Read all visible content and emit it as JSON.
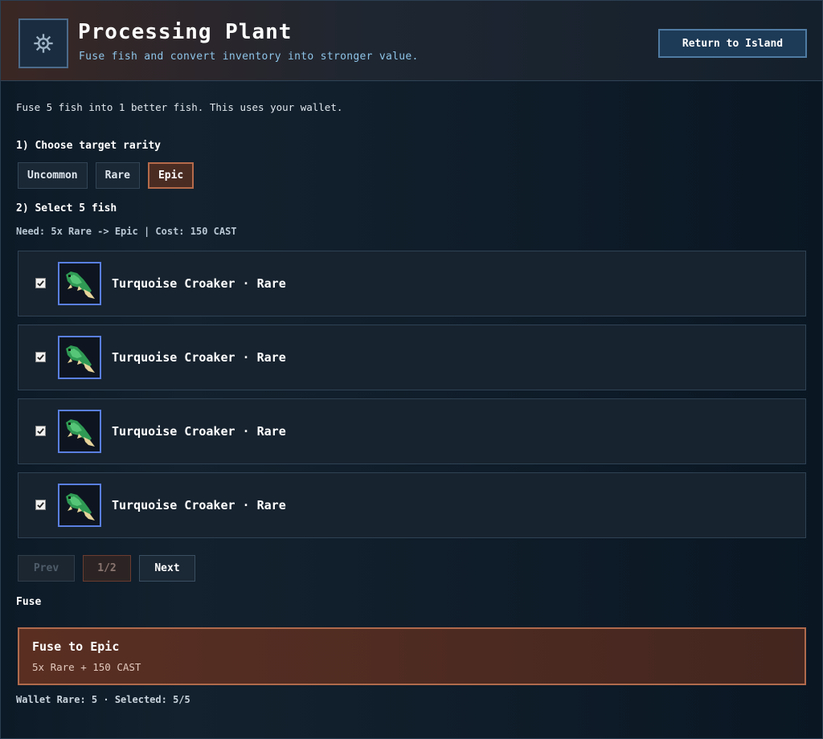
{
  "header": {
    "title": "Processing Plant",
    "subtitle": "Fuse fish and convert inventory into stronger value.",
    "icon": "gear-icon",
    "return_label": "Return to Island"
  },
  "intro": "Fuse 5 fish into 1 better fish. This uses your wallet.",
  "step1": {
    "label": "1) Choose target rarity",
    "options": [
      "Uncommon",
      "Rare",
      "Epic"
    ],
    "selected": "Epic"
  },
  "step2": {
    "label": "2) Select 5 fish",
    "need": "Need: 5x Rare -> Epic | Cost: 150 CAST"
  },
  "fish": [
    {
      "name": "Turquoise Croaker · Rare",
      "checked": true,
      "icon": "fish-icon"
    },
    {
      "name": "Turquoise Croaker · Rare",
      "checked": true,
      "icon": "fish-icon"
    },
    {
      "name": "Turquoise Croaker · Rare",
      "checked": true,
      "icon": "fish-icon"
    },
    {
      "name": "Turquoise Croaker · Rare",
      "checked": true,
      "icon": "fish-icon"
    }
  ],
  "pager": {
    "prev": "Prev",
    "page": "1/2",
    "next": "Next"
  },
  "fuse": {
    "section_label": "Fuse",
    "button_title": "Fuse to Epic",
    "button_sub": "5x Rare + 150 CAST"
  },
  "wallet_status": "Wallet Rare: 5 · Selected: 5/5",
  "colors": {
    "accent_orange": "#b06a4c",
    "accent_blue": "#4f7ba3",
    "thumb_border": "#5a7fe0"
  }
}
